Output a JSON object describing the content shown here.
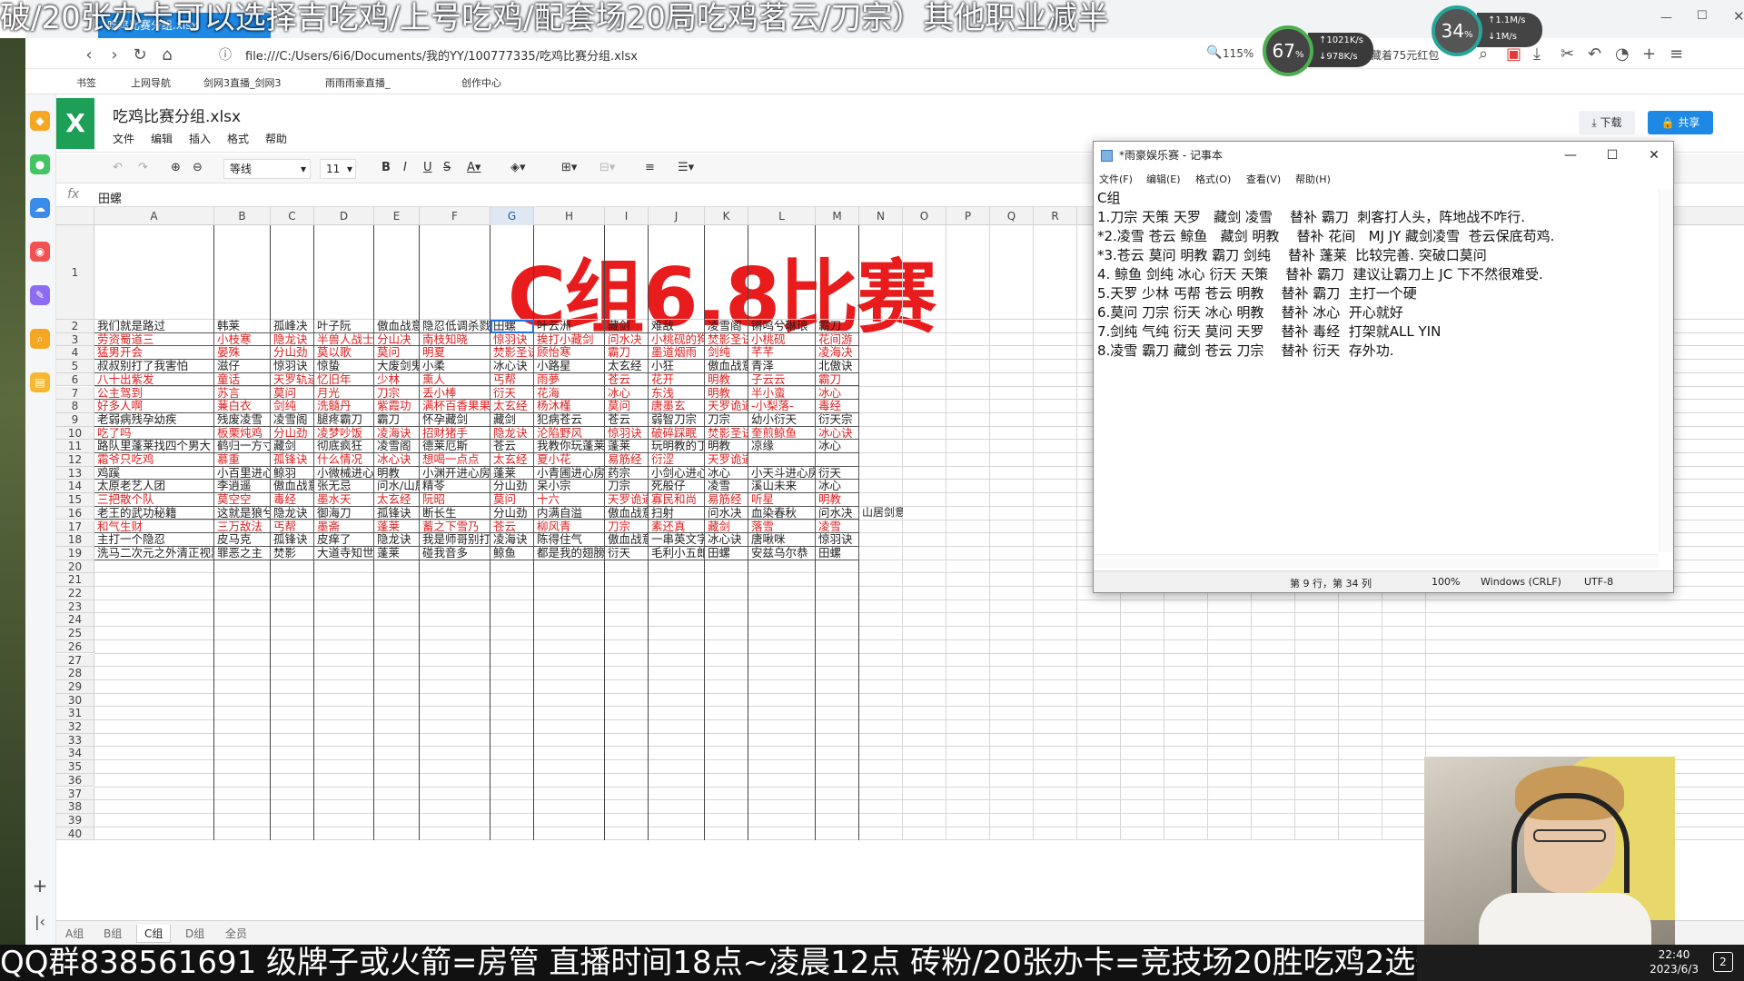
{
  "overlay": {
    "top_ticker": "破/20张办卡可以选择吉吃鸡/上号吃鸡/配套场20局吃鸡茗云/刀宗）其他职业减半",
    "bottom_ticker": "QQ群838561691     级牌子或火箭=房管   直播时间18点~凌晨12点   砖粉/20张办卡=竞技场20胜吃鸡2选一",
    "clock_time": "22:40",
    "clock_date": "2023/6/3"
  },
  "browser": {
    "tab_title": "吃鸡比赛分组.xlsx",
    "url": "file:///C:/Users/6i6/Documents/我的YY/100777335/吃鸡比赛分组.xlsx",
    "zoom": "115%",
    "right_note": "盲区里藏着75元红包",
    "speed1": {
      "value": "67",
      "unit": "%",
      "up": "1021",
      "down": "978"
    },
    "speed2": {
      "value": "34",
      "unit": "%",
      "up": "1.1M/s",
      "down": "1M/s"
    },
    "bookmarks": [
      "书签",
      "上网导航",
      "剑网3直播_剑网3",
      "雨雨雨豪直播_",
      "创作中心"
    ]
  },
  "app": {
    "filename": "吃鸡比赛分组.xlsx",
    "menu": [
      "文件",
      "编辑",
      "插入",
      "格式",
      "帮助"
    ],
    "download_label": "下载",
    "share_label": "共享",
    "font_name": "等线",
    "font_size": "11",
    "formula_value": "田螺",
    "columns": [
      "A",
      "B",
      "C",
      "D",
      "E",
      "F",
      "G",
      "H",
      "I",
      "J",
      "K",
      "L",
      "M",
      "N",
      "O",
      "P",
      "Q",
      "R",
      "S",
      "T",
      "U",
      "V",
      "W",
      "X",
      "Y",
      "Z"
    ],
    "title_cell": "C组6.8比赛",
    "sheet_tabs": [
      "A组",
      "B组",
      "C组",
      "D组",
      "全员"
    ],
    "extra_cell": "山居剑意"
  },
  "table": {
    "rows": [
      [
        "我们就是路过",
        "韩莱",
        "孤峰决",
        "叶子阮",
        "傲血战意",
        "隐忍低调杀戮",
        "田螺",
        "叶云洲",
        "藏剑",
        "难敌",
        "凌雪阁",
        "锵鸣兮琳琅",
        "霸刀"
      ],
      [
        "劳资蜀道三",
        "小枝寒",
        "隐龙诀",
        "半兽人战士",
        "分山决",
        "南枝知晓",
        "惊羽诀",
        "挨打小藏剑",
        "问水决",
        "小桃砚的狗",
        "焚影圣诀",
        "小桃砚",
        "花间游"
      ],
      [
        "猛男开会",
        "晏殊",
        "分山劲",
        "莫以歌",
        "莫问",
        "明夏",
        "焚影圣诀",
        "顾怡寒",
        "霸刀",
        "墨道烟雨",
        "剑纯",
        "芊芊",
        "凌海决"
      ],
      [
        "叔叔别打了我害怕",
        "滋仔",
        "惊羽诀",
        "惊蛰",
        "大废剑鬼",
        "小柔",
        "冰心诀",
        "小路星",
        "太玄经",
        "小狂",
        "傲血战意",
        "青泽",
        "北傲诀"
      ],
      [
        "八十出紫发",
        "童话",
        "天罗轨迹",
        "忆旧年",
        "少林",
        "熏人",
        "丐帮",
        "雨夢",
        "苍云",
        "花开",
        "明教",
        "子云云",
        "霸刀"
      ],
      [
        "公主驾到",
        "苏言",
        "莫问",
        "月光",
        "刀宗",
        "丢小棒",
        "衍天",
        "花海",
        "冰心",
        "东浅",
        "明教",
        "半小蛮",
        "冰心"
      ],
      [
        "好多人啊",
        "蒹白衣",
        "剑纯",
        "洗髓丹",
        "紫霞功",
        "满杯百香果果",
        "太玄经",
        "杨沐槿",
        "莫问",
        "唐墨玄",
        "天罗诡道",
        "-小梨落-",
        "毒经"
      ],
      [
        "老弱病残孕幼疾",
        "残废凌雪",
        "凌雪阁",
        "腿疼霸刀",
        "霸刀",
        "怀孕藏剑",
        "藏剑",
        "犯病苍云",
        "苍云",
        "弱智刀宗",
        "刀宗",
        "幼小衍天",
        "衍天宗"
      ],
      [
        "吃了吗",
        "板栗炖鸡",
        "分山劲",
        "凌梦吵饭",
        "凌海诀",
        "招财猪手",
        "隐龙诀",
        "沦陷野风",
        "惊羽诀",
        "破碎踩眠",
        "焚影圣诀",
        "奎煎鲸鱼",
        "冰心诀"
      ],
      [
        "路队里蓬莱找四个男大",
        "鹤归一方寸",
        "藏剑",
        "彻底疯狂",
        "凌雪阁",
        "德莱厄斯",
        "苍云",
        "我教你玩蓬莱",
        "蓬莱",
        "玩明教的丁",
        "明教",
        "凉缘",
        "冰心"
      ],
      [
        "霜爷只吃鸡",
        "慕重",
        "孤锋诀",
        "什么情况",
        "冰心诀",
        "想喝一点点",
        "太玄经",
        "夏小花",
        "易筋经",
        "衍涩",
        "天罗诡道",
        "",
        ""
      ],
      [
        "鸡蹊",
        "小百里进心",
        "鲸羽",
        "小微械进心",
        "明教",
        "小渊开进心房",
        "蓬莱",
        "小青圃进心房",
        "药宗",
        "小剑心进心",
        "冰心",
        "小天斗进心房",
        "衍天"
      ],
      [
        "太原老艺人团",
        "李逍遥",
        "傲血战意",
        "张无忌",
        "问水/山居",
        "精苓",
        "分山劲",
        "呆小宗",
        "刀宗",
        "死般仔",
        "凌雪",
        "溪山未来",
        "冰心"
      ],
      [
        "三把散个队",
        "莫空空",
        "毒经",
        "墨水天",
        "太玄经",
        "阮昭",
        "莫问",
        "十六",
        "天罗诡道",
        "寡民和尚",
        "易筋经",
        "听星",
        "明教"
      ],
      [
        "老王的武功秘籍",
        "这就是狼兮",
        "隐龙诀",
        "御海刀",
        "孤锋诀",
        "断长生",
        "分山劲",
        "内满自溢",
        "傲血战意",
        "扫射",
        "问水决",
        "血染春秋",
        "问水决"
      ],
      [
        "和气生财",
        "三万敌法",
        "丐帮",
        "墨斋",
        "蓬莱",
        "蓄之下雪乃",
        "苍云",
        "柳风青",
        "刀宗",
        "素还真",
        "藏剑",
        "落雪",
        "凌雪"
      ],
      [
        "主打一个隐忍",
        "皮马克",
        "孤锋诀",
        "皮痒了",
        "隐龙诀",
        "我是师哥别打",
        "凌海诀",
        "陈得住气",
        "傲血战意",
        "一串英文字",
        "冰心诀",
        "唐啾咪",
        "惊羽诀"
      ],
      [
        "洗马二次元之外清正视嵩",
        "罪恶之主",
        "焚影",
        "大道寺知世",
        "蓬莱",
        "碰我音多",
        "鲸鱼",
        "都是我的翅膀",
        "衍天",
        "毛利小五郎",
        "田螺",
        "安兹乌尔恭",
        "田螺"
      ]
    ],
    "red_rows": [
      1,
      2,
      4,
      5,
      6,
      8,
      10,
      13,
      15
    ]
  },
  "notepad": {
    "title": "*雨豪娱乐赛 - 记事本",
    "menu": [
      "文件(F)",
      "编辑(E)",
      "格式(O)",
      "查看(V)",
      "帮助(H)"
    ],
    "text": "C组\n1.刀宗 天策 天罗   藏剑 凌雪    替补 霸刀  刺客打人头，阵地战不咋行.\n*2.凌雪 苍云 鲸鱼   藏剑 明教    替补 花间   MJ JY 藏剑凌雪  苍云保底苟鸡.\n*3.苍云 莫问 明教 霸刀 剑纯    替补 蓬莱  比较完善. 突破口莫问\n4. 鲸鱼 剑纯 冰心 衍天 天策    替补 霸刀  建议让霸刀上 JC 下不然很难受.\n5.天罗 少林 丐帮 苍云 明教    替补 霸刀  主打一个硬\n6.莫问 刀宗 衍天 冰心 明教    替补 冰心  开心就好\n7.剑纯 气纯 衍天 莫问 天罗    替补 毒经  打架就ALL YIN\n8.凌雪 霸刀 藏剑 苍云 刀宗    替补 衍天  存外功.",
    "status_pos": "第 9 行，第 34 列",
    "status_zoom": "100%",
    "status_eol": "Windows (CRLF)",
    "status_enc": "UTF-8"
  }
}
